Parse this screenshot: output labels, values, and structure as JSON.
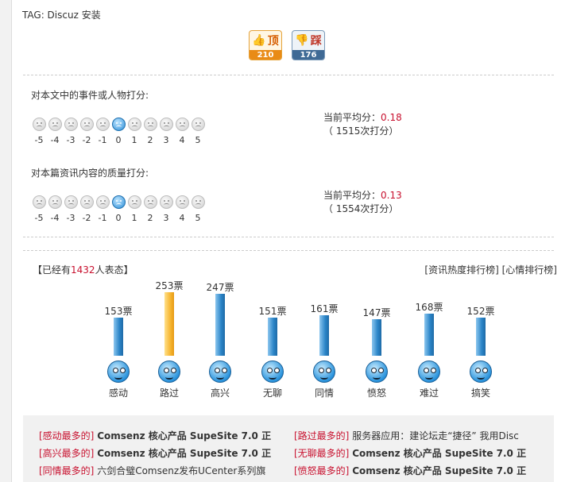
{
  "tag": "TAG: Discuz 安装",
  "vote": {
    "ding_label": "顶",
    "ding_count": "210",
    "cai_label": "踩",
    "cai_count": "176"
  },
  "rating_event": {
    "label": "对本文中的事件或人物打分:",
    "scale": [
      "-5",
      "-4",
      "-3",
      "-2",
      "-1",
      "0",
      "1",
      "2",
      "3",
      "4",
      "5"
    ],
    "selected_index": 5,
    "avg_prefix": "当前平均分：",
    "avg_value": "0.18",
    "avg_suffix": "（ 1515次打分）"
  },
  "rating_quality": {
    "label": "对本篇资讯内容的质量打分:",
    "scale": [
      "-5",
      "-4",
      "-3",
      "-2",
      "-1",
      "0",
      "1",
      "2",
      "3",
      "4",
      "5"
    ],
    "selected_index": 5,
    "avg_prefix": "当前平均分：",
    "avg_value": "0.13",
    "avg_suffix": "（ 1554次打分）"
  },
  "mood": {
    "head_prefix": "【已经有",
    "head_count": "1432",
    "head_suffix": "人表态】",
    "rank_news": "[资讯热度排行榜]",
    "rank_mood": "[心情排行榜]",
    "max_votes": 253,
    "items": [
      {
        "name": "感动",
        "votes": 153,
        "label": "153票"
      },
      {
        "name": "路过",
        "votes": 253,
        "label": "253票"
      },
      {
        "name": "高兴",
        "votes": 247,
        "label": "247票"
      },
      {
        "name": "无聊",
        "votes": 151,
        "label": "151票"
      },
      {
        "name": "同情",
        "votes": 161,
        "label": "161票"
      },
      {
        "name": "愤怒",
        "votes": 147,
        "label": "147票"
      },
      {
        "name": "难过",
        "votes": 168,
        "label": "168票"
      },
      {
        "name": "搞笑",
        "votes": 152,
        "label": "152票"
      }
    ]
  },
  "top_links": {
    "left": [
      {
        "cat": "[感动最多的]",
        "title": "Comsenz 核心产品  SupeSite 7.0 正",
        "bold": true
      },
      {
        "cat": "[高兴最多的]",
        "title": "Comsenz 核心产品  SupeSite 7.0 正",
        "bold": true
      },
      {
        "cat": "[同情最多的]",
        "title": "六剑合璧Comsenz发布UCenter系列旗",
        "bold": false
      }
    ],
    "right": [
      {
        "cat": "[路过最多的]",
        "title": "服务器应用：建论坛走“捷径” 我用Disc",
        "bold": false
      },
      {
        "cat": "[无聊最多的]",
        "title": "Comsenz 核心产品  SupeSite 7.0 正",
        "bold": true
      },
      {
        "cat": "[愤怒最多的]",
        "title": "Comsenz 核心产品  SupeSite 7.0 正",
        "bold": true
      }
    ]
  }
}
